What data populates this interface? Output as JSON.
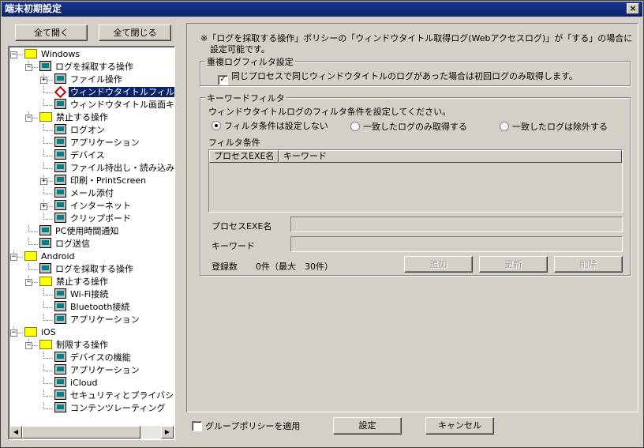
{
  "window": {
    "title": "端末初期設定",
    "close": "×"
  },
  "left_buttons": {
    "expand_all": "全て開く",
    "collapse_all": "全て閉じる"
  },
  "tree": [
    {
      "label": "Windows",
      "level": 0,
      "icon": "folder-icon",
      "expander": "−"
    },
    {
      "label": "ログを採取する操作",
      "level": 1,
      "icon": "computer-icon",
      "expander": "−"
    },
    {
      "label": "ファイル操作",
      "level": 2,
      "icon": "computer-icon",
      "expander": "+"
    },
    {
      "label": "ウィンドウタイトルフィルタ",
      "level": 2,
      "icon": "diamond-icon",
      "expander": "",
      "selected": true
    },
    {
      "label": "ウィンドウタイトル画面キャ",
      "level": 2,
      "icon": "computer-icon",
      "expander": ""
    },
    {
      "label": "禁止する操作",
      "level": 1,
      "icon": "folder-icon",
      "expander": "−"
    },
    {
      "label": "ログオン",
      "level": 2,
      "icon": "computer-icon",
      "expander": ""
    },
    {
      "label": "アプリケーション",
      "level": 2,
      "icon": "computer-icon",
      "expander": ""
    },
    {
      "label": "デバイス",
      "level": 2,
      "icon": "computer-icon",
      "expander": ""
    },
    {
      "label": "ファイル持出し・読み込み",
      "level": 2,
      "icon": "computer-icon",
      "expander": ""
    },
    {
      "label": "印刷・PrintScreen",
      "level": 2,
      "icon": "computer-icon",
      "expander": "+"
    },
    {
      "label": "メール添付",
      "level": 2,
      "icon": "computer-icon",
      "expander": ""
    },
    {
      "label": "インターネット",
      "level": 2,
      "icon": "computer-icon",
      "expander": "+"
    },
    {
      "label": "クリップボード",
      "level": 2,
      "icon": "computer-icon",
      "expander": ""
    },
    {
      "label": "PC使用時間通知",
      "level": 1,
      "icon": "computer-icon",
      "expander": ""
    },
    {
      "label": "ログ送信",
      "level": 1,
      "icon": "computer-icon",
      "expander": ""
    },
    {
      "label": "Android",
      "level": 0,
      "icon": "folder-icon",
      "expander": "−"
    },
    {
      "label": "ログを採取する操作",
      "level": 1,
      "icon": "computer-icon",
      "expander": ""
    },
    {
      "label": "禁止する操作",
      "level": 1,
      "icon": "folder-icon",
      "expander": "−"
    },
    {
      "label": "Wi-Fi接続",
      "level": 2,
      "icon": "computer-icon",
      "expander": ""
    },
    {
      "label": "Bluetooth接続",
      "level": 2,
      "icon": "computer-icon",
      "expander": ""
    },
    {
      "label": "アプリケーション",
      "level": 2,
      "icon": "computer-icon",
      "expander": ""
    },
    {
      "label": "iOS",
      "level": 0,
      "icon": "folder-icon",
      "expander": "−"
    },
    {
      "label": "制限する操作",
      "level": 1,
      "icon": "folder-icon",
      "expander": "−"
    },
    {
      "label": "デバイスの機能",
      "level": 2,
      "icon": "computer-icon",
      "expander": ""
    },
    {
      "label": "アプリケーション",
      "level": 2,
      "icon": "computer-icon",
      "expander": ""
    },
    {
      "label": "iCloud",
      "level": 2,
      "icon": "computer-icon",
      "expander": ""
    },
    {
      "label": "セキュリティとプライバシー",
      "level": 2,
      "icon": "computer-icon",
      "expander": ""
    },
    {
      "label": "コンテンツレーティング",
      "level": 2,
      "icon": "computer-icon",
      "expander": ""
    }
  ],
  "scroll": {
    "left": "◀",
    "right": "▶"
  },
  "notice": {
    "line1": "※「ログを採取する操作」ポリシーの「ウィンドウタイトル取得ログ(Webアクセスログ)」が「する」の場合に",
    "line2": "設定可能です。"
  },
  "dup_filter": {
    "title": "重複ログフィルタ設定",
    "check_mark": "✓",
    "checkbox_label": "同じプロセスで同じウィンドウタイトルのログがあった場合は初回ログのみ取得します。"
  },
  "keyword_filter": {
    "title": "キーワードフィルタ",
    "instruction": "ウィンドウタイトルログのフィルタ条件を設定してください。",
    "radio_none": "フィルタ条件は設定しない",
    "radio_match_only": "一致したログのみ取得する",
    "radio_exclude": "一致したログは除外する",
    "conditions_label": "フィルタ条件",
    "col_process": "プロセスEXE名",
    "col_keyword": "キーワード",
    "process_label": "プロセスEXE名",
    "keyword_label": "キーワード",
    "count_label": "登録数",
    "count_value": "0件（最大　30件）",
    "add": "追加",
    "update": "更新",
    "delete": "削除"
  },
  "footer": {
    "group_policy": "グループポリシーを適用",
    "set": "設定",
    "cancel": "キャンセル"
  }
}
